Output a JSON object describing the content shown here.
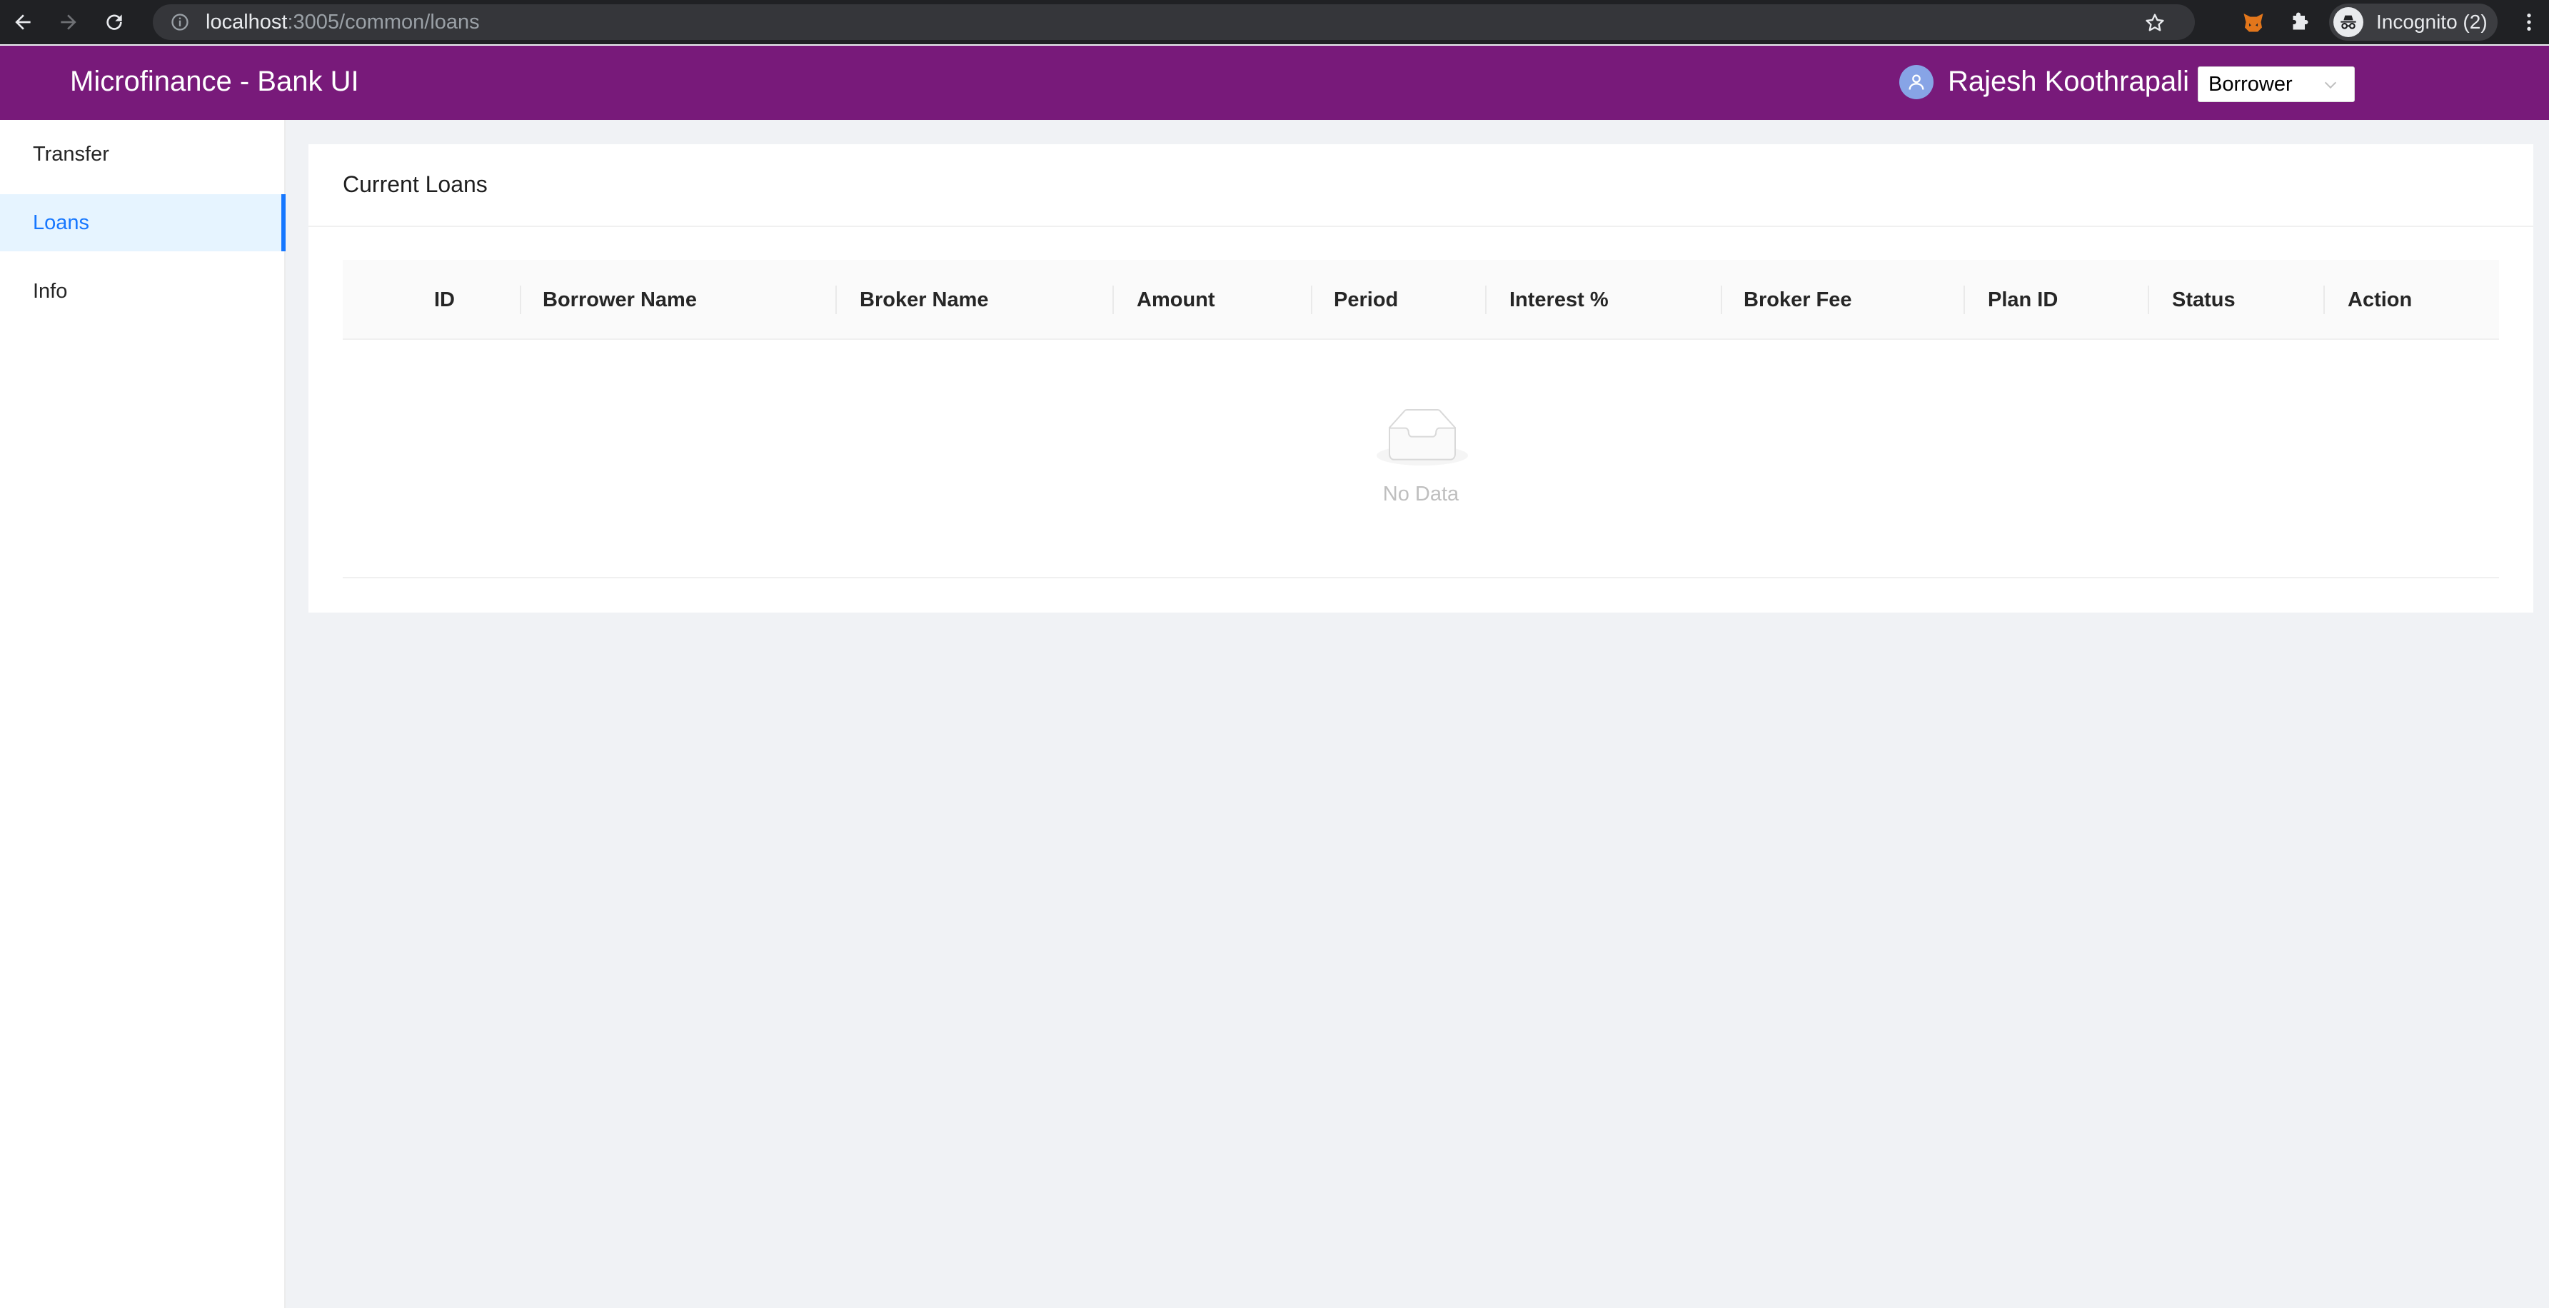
{
  "browser": {
    "url_host": "localhost",
    "url_rest": ":3005/common/loans",
    "profile_label": "Incognito (2)",
    "icons": [
      "back-icon",
      "forward-icon",
      "reload-icon",
      "info-icon",
      "star-icon",
      "fox-extension-icon",
      "puzzle-icon",
      "incognito-icon",
      "kebab-menu-icon"
    ]
  },
  "header": {
    "title": "Microfinance - Bank UI",
    "user_name": "Rajesh Koothrapali",
    "role_selected": "Borrower",
    "colors": {
      "header_bg": "#781a7a",
      "avatar_bg": "#87a4e6"
    }
  },
  "sidebar": {
    "items": [
      {
        "label": "Transfer",
        "active": false
      },
      {
        "label": "Loans",
        "active": true
      },
      {
        "label": "Info",
        "active": false
      }
    ],
    "colors": {
      "active_text": "#1677ff",
      "active_bg": "#e6f4ff"
    }
  },
  "main": {
    "card_title": "Current Loans",
    "table": {
      "columns": [
        "ID",
        "Borrower Name",
        "Broker Name",
        "Amount",
        "Period",
        "Interest %",
        "Broker Fee",
        "Plan ID",
        "Status",
        "Action"
      ],
      "rows": [],
      "empty_text": "No Data"
    }
  }
}
